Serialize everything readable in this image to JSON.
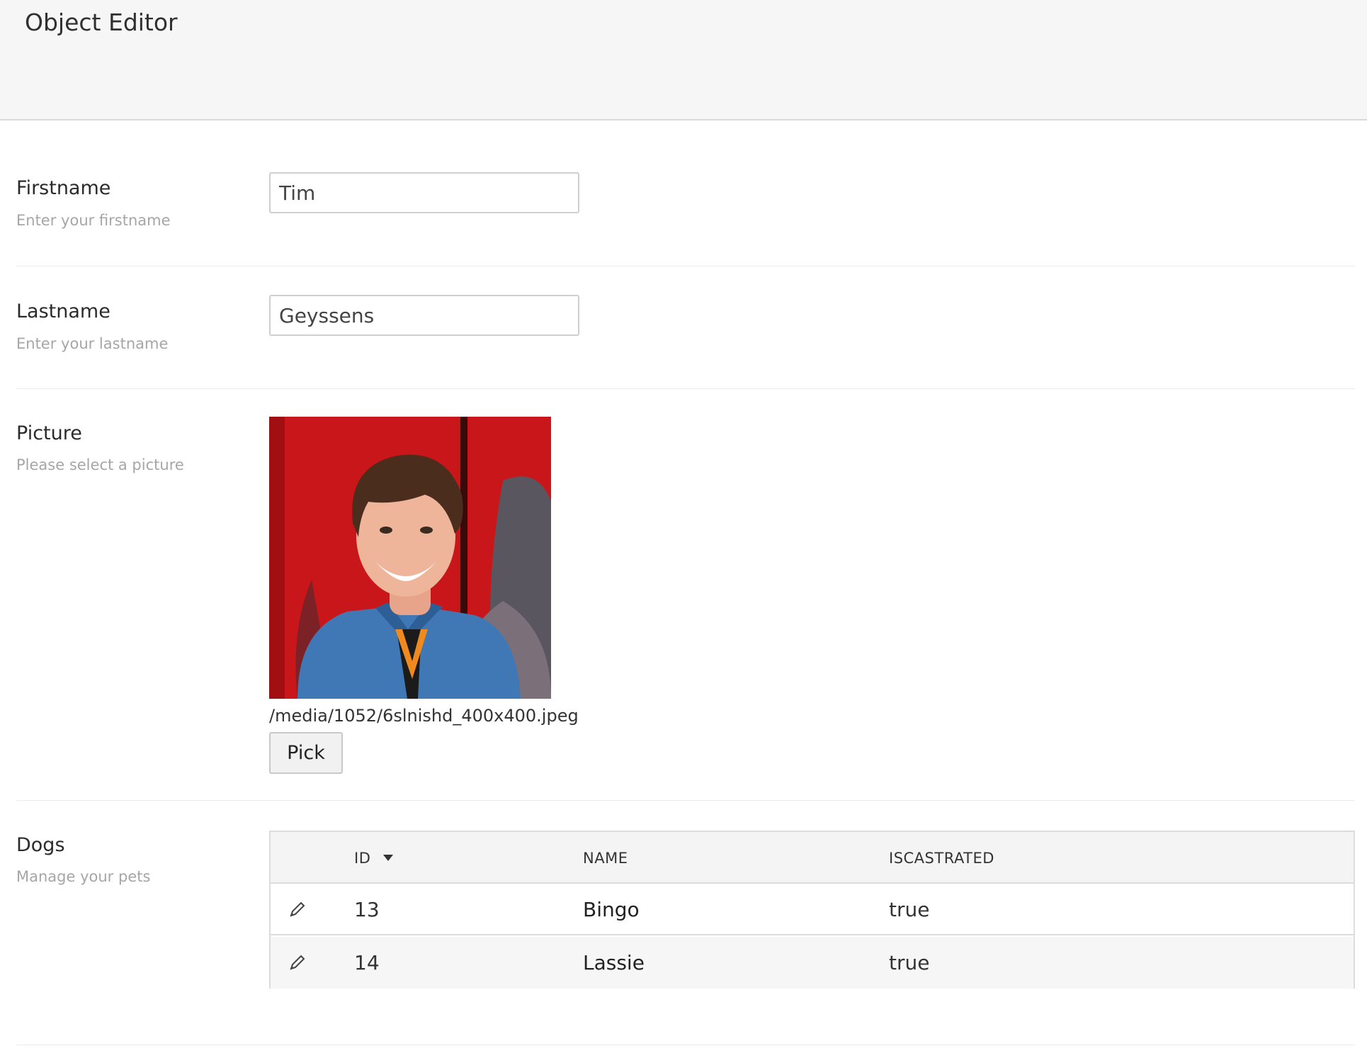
{
  "header": {
    "title": "Object Editor"
  },
  "form": {
    "firstname": {
      "label": "Firstname",
      "description": "Enter your firstname",
      "value": "Tim"
    },
    "lastname": {
      "label": "Lastname",
      "description": "Enter your lastname",
      "value": "Geyssens"
    },
    "picture": {
      "label": "Picture",
      "description": "Please select a picture",
      "path": "/media/1052/6slnishd_400x400.jpeg",
      "pick_label": "Pick"
    },
    "dogs": {
      "label": "Dogs",
      "description": "Manage your pets",
      "columns": [
        "ID",
        "NAME",
        "ISCASTRATED"
      ],
      "sort_icon": "sort-desc-triangle-icon",
      "rows": [
        {
          "id": "13",
          "name": "Bingo",
          "iscastrated": "true"
        },
        {
          "id": "14",
          "name": "Lassie",
          "iscastrated": "true"
        }
      ]
    }
  },
  "icons": {
    "edit": "pencil-icon"
  },
  "colors": {
    "header_bg": "#f6f6f6",
    "photo_bg": "#c8161a",
    "shirt": "#3f78b5",
    "lanyard": "#f08a1e"
  }
}
